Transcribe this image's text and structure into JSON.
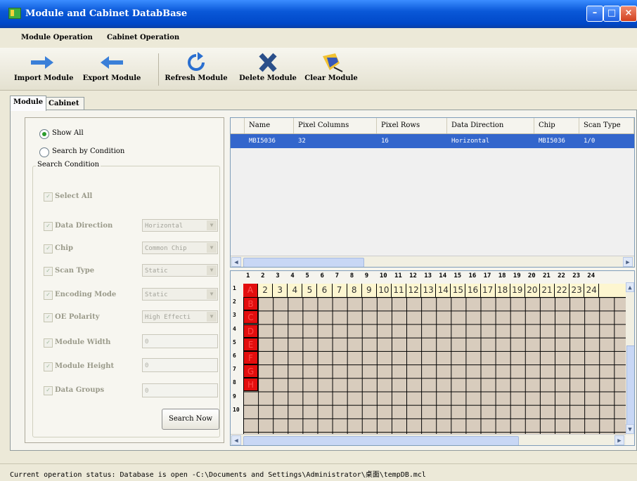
{
  "window": {
    "title": "Module and Cabinet DatabBase"
  },
  "menu": [
    "Module Operation",
    "Cabinet Operation"
  ],
  "toolbar": {
    "import_label": "Import Module",
    "export_label": "Export Module",
    "refresh_label": "Refresh Module",
    "delete_label": "Delete Module",
    "clear_label": "Clear Module"
  },
  "tabs": [
    "Module",
    "Cabinet"
  ],
  "filter": {
    "show_all": "Show All",
    "search_by_condition": "Search by Condition",
    "group_title": "Search Condition",
    "select_all": "Select All",
    "conditions": [
      {
        "label": "Data Direction",
        "value": "Horizontal"
      },
      {
        "label": "Chip",
        "value": "Common Chip"
      },
      {
        "label": "Scan Type",
        "value": "Static"
      },
      {
        "label": "Encoding Mode",
        "value": "Static"
      },
      {
        "label": "OE Polarity",
        "value": "High Effecti"
      },
      {
        "label": "Module Width",
        "value": "0"
      },
      {
        "label": "Module Height",
        "value": "0"
      },
      {
        "label": "Data Groups",
        "value": "0"
      }
    ],
    "search_button": "Search Now"
  },
  "module_table": {
    "columns": [
      "Name",
      "Pixel Columns",
      "Pixel Rows",
      "Data Direction",
      "Chip",
      "Scan Type"
    ],
    "rows": [
      [
        "MBI5036",
        "32",
        "16",
        "Horizontal",
        "MBI5036",
        "1/0"
      ]
    ]
  },
  "pixel_grid": {
    "column_numbers": [
      "1",
      "2",
      "3",
      "4",
      "5",
      "6",
      "7",
      "8",
      "9",
      "10",
      "11",
      "12",
      "13",
      "14",
      "15",
      "16",
      "17",
      "18",
      "19",
      "20",
      "21",
      "22",
      "23",
      "24"
    ],
    "row_numbers": [
      "1",
      "2",
      "3",
      "4",
      "5",
      "6",
      "7",
      "8",
      "9",
      "10"
    ],
    "first_row_labels": [
      "A",
      "2",
      "3",
      "4",
      "5",
      "6",
      "7",
      "8",
      "9",
      "10",
      "11",
      "12",
      "13",
      "14",
      "15",
      "16",
      "17",
      "18",
      "19",
      "20",
      "21",
      "22",
      "23",
      "24"
    ],
    "first_column_labels": [
      "B",
      "C",
      "D",
      "E",
      "F",
      "G",
      "H"
    ],
    "highlight_color": "#e30e0e"
  },
  "status": {
    "text": "Current operation status: Database is open -C:\\Documents and Settings\\Administrator\\桌面\\tempDB.mcl"
  }
}
